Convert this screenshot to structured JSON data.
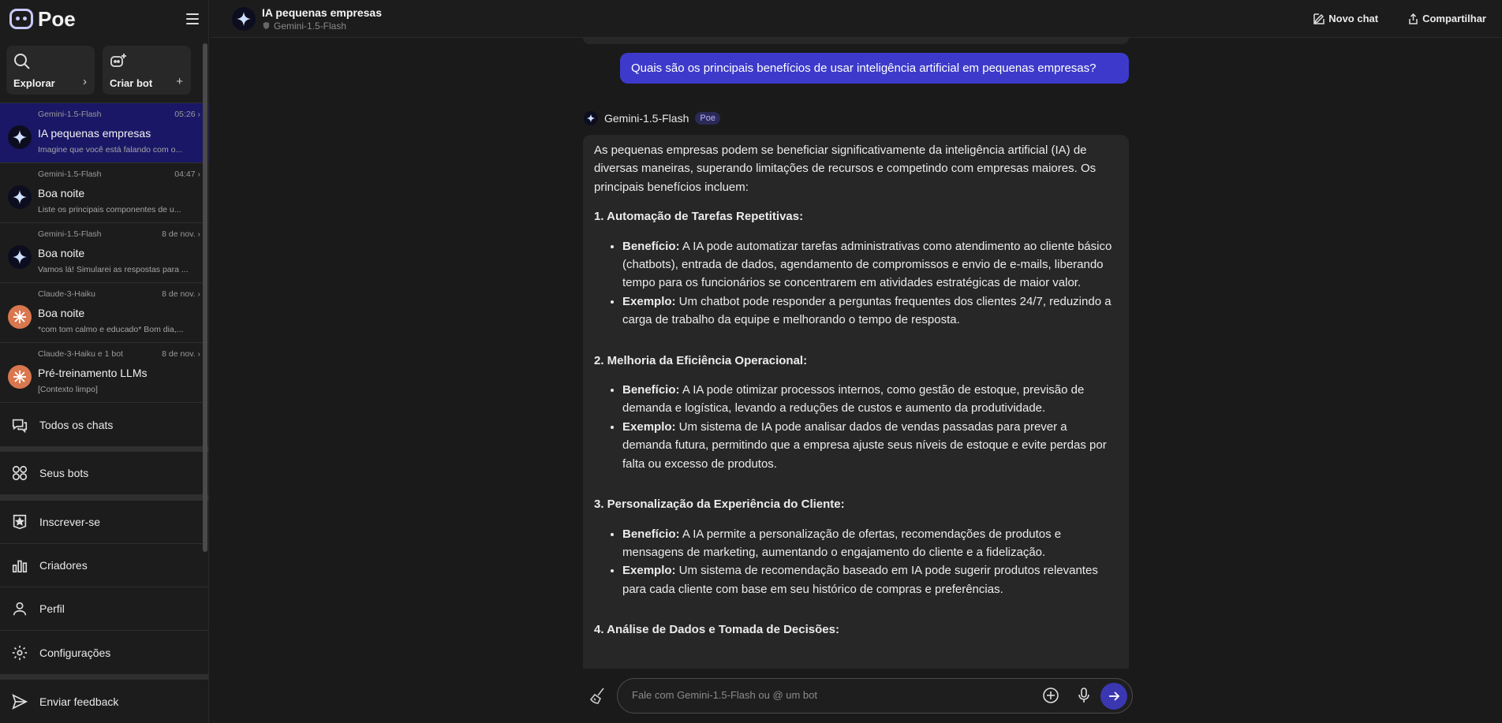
{
  "app": {
    "logo": "Poe"
  },
  "sidebar": {
    "explore_label": "Explorar",
    "create_bot_label": "Criar bot",
    "chats": [
      {
        "bot": "Gemini-1.5-Flash",
        "time": "05:26",
        "title": "IA pequenas empresas",
        "snippet": "Imagine que você está falando com o...",
        "avatar": "gemini-icon",
        "active": true
      },
      {
        "bot": "Gemini-1.5-Flash",
        "time": "04:47",
        "title": "Boa noite",
        "snippet": "Liste os principais componentes de u...",
        "avatar": "gemini-icon",
        "active": false
      },
      {
        "bot": "Gemini-1.5-Flash",
        "time": "8 de nov.",
        "title": "Boa noite",
        "snippet": "Vamos lá! Simularei as respostas para ...",
        "avatar": "gemini-icon",
        "active": false
      },
      {
        "bot": "Claude-3-Haiku",
        "time": "8 de nov.",
        "title": "Boa noite",
        "snippet": "*com tom calmo e educado* Bom dia,...",
        "avatar": "claude-icon",
        "active": false
      },
      {
        "bot": "Claude-3-Haiku e 1 bot",
        "time": "8 de nov.",
        "title": "Pré-treinamento LLMs",
        "snippet": "[Contexto limpo]",
        "avatar": "claude-icon",
        "active": false
      }
    ],
    "nav": {
      "all_chats": "Todos os chats",
      "your_bots": "Seus bots",
      "subscribe": "Inscrever-se",
      "creators": "Criadores",
      "profile": "Perfil",
      "settings": "Configurações",
      "feedback": "Enviar feedback"
    }
  },
  "header": {
    "title": "IA pequenas empresas",
    "subtitle": "Gemini-1.5-Flash",
    "new_chat": "Novo chat",
    "share": "Compartilhar"
  },
  "conversation": {
    "user_message": "Quais são os principais benefícios de usar inteligência artificial em pequenas empresas?",
    "bot_name": "Gemini-1.5-Flash",
    "bot_badge": "Poe",
    "intro": "As pequenas empresas podem se beneficiar significativamente da inteligência artificial (IA) de diversas maneiras, superando limitações de recursos e competindo com empresas maiores. Os principais benefícios incluem:",
    "sections": [
      {
        "heading": "1. Automação de Tarefas Repetitivas:",
        "benefit_label": "Benefício:",
        "benefit": " A IA pode automatizar tarefas administrativas como atendimento ao cliente básico (chatbots), entrada de dados, agendamento de compromissos e envio de e-mails, liberando tempo para os funcionários se concentrarem em atividades estratégicas de maior valor.",
        "example_label": "Exemplo:",
        "example": " Um chatbot pode responder a perguntas frequentes dos clientes 24/7, reduzindo a carga de trabalho da equipe e melhorando o tempo de resposta."
      },
      {
        "heading": "2. Melhoria da Eficiência Operacional:",
        "benefit_label": "Benefício:",
        "benefit": " A IA pode otimizar processos internos, como gestão de estoque, previsão de demanda e logística, levando a reduções de custos e aumento da produtividade.",
        "example_label": "Exemplo:",
        "example": " Um sistema de IA pode analisar dados de vendas passadas para prever a demanda futura, permitindo que a empresa ajuste seus níveis de estoque e evite perdas por falta ou excesso de produtos."
      },
      {
        "heading": "3. Personalização da Experiência do Cliente:",
        "benefit_label": "Benefício:",
        "benefit": " A IA permite a personalização de ofertas, recomendações de produtos e mensagens de marketing, aumentando o engajamento do cliente e a fidelização.",
        "example_label": "Exemplo:",
        "example": " Um sistema de recomendação baseado em IA pode sugerir produtos relevantes para cada cliente com base em seu histórico de compras e preferências."
      },
      {
        "heading": "4. Análise de Dados e Tomada de Decisões:"
      }
    ]
  },
  "composer": {
    "placeholder": "Fale com Gemini-1.5-Flash ou @ um bot"
  },
  "colors": {
    "accent": "#3d3acb",
    "active_chat": "#1a1766"
  }
}
